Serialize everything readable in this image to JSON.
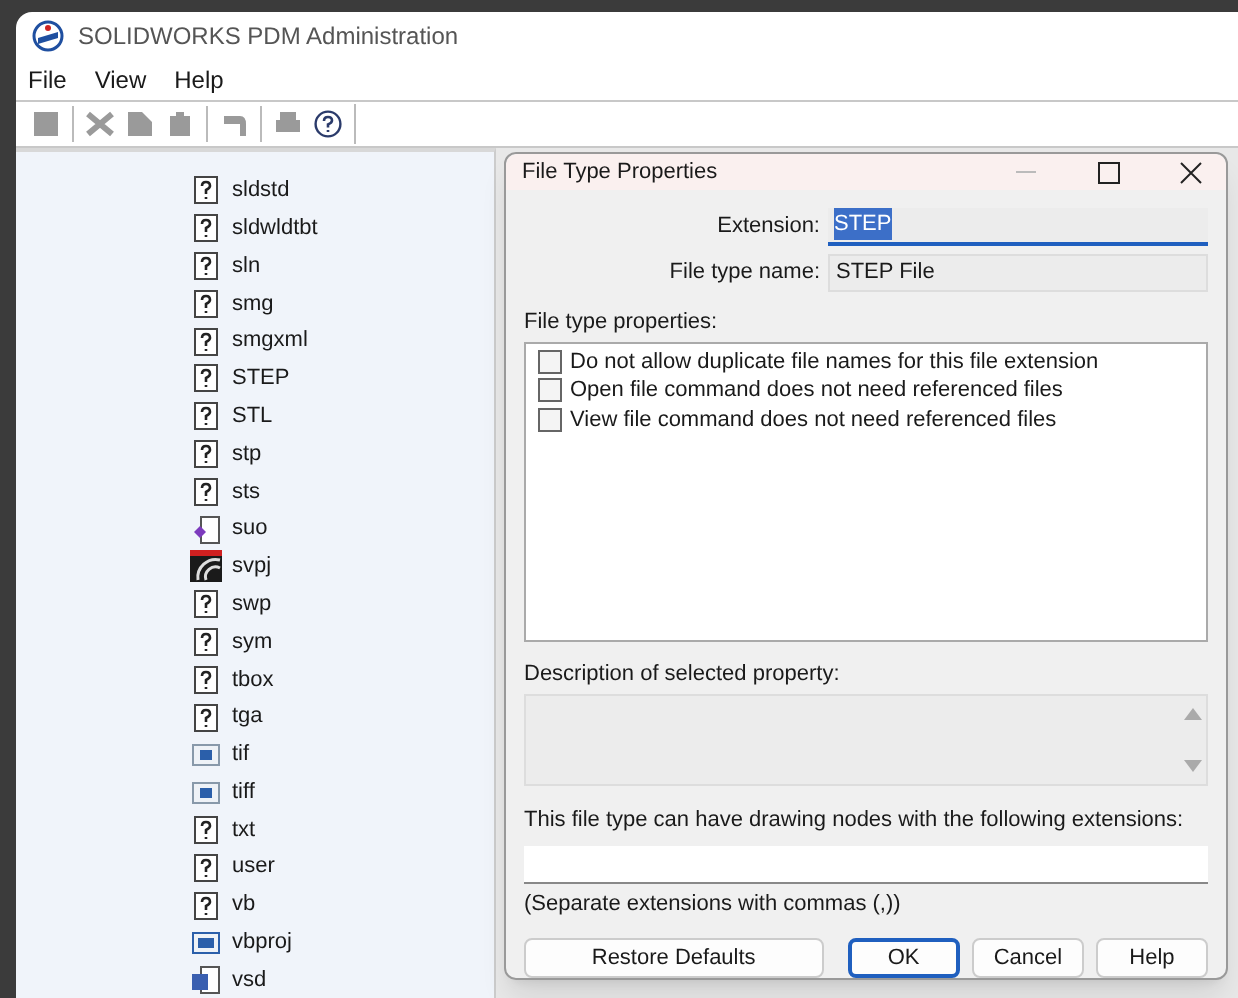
{
  "window": {
    "title": "SOLIDWORKS PDM Administration"
  },
  "menu": [
    "File",
    "View",
    "Help"
  ],
  "tree": {
    "items": [
      {
        "label": "sldstd",
        "kind": "unknown"
      },
      {
        "label": "sldwldtbt",
        "kind": "unknown"
      },
      {
        "label": "sln",
        "kind": "unknown"
      },
      {
        "label": "smg",
        "kind": "unknown"
      },
      {
        "label": "smgxml",
        "kind": "unknown"
      },
      {
        "label": "STEP",
        "kind": "unknown"
      },
      {
        "label": "STL",
        "kind": "unknown"
      },
      {
        "label": "stp",
        "kind": "unknown"
      },
      {
        "label": "sts",
        "kind": "unknown"
      },
      {
        "label": "suo",
        "kind": "solution"
      },
      {
        "label": "svpj",
        "kind": "svpj"
      },
      {
        "label": "swp",
        "kind": "unknown"
      },
      {
        "label": "sym",
        "kind": "unknown"
      },
      {
        "label": "tbox",
        "kind": "unknown"
      },
      {
        "label": "tga",
        "kind": "unknown"
      },
      {
        "label": "tif",
        "kind": "image"
      },
      {
        "label": "tiff",
        "kind": "image"
      },
      {
        "label": "txt",
        "kind": "unknown"
      },
      {
        "label": "user",
        "kind": "unknown"
      },
      {
        "label": "vb",
        "kind": "unknown"
      },
      {
        "label": "vbproj",
        "kind": "vb"
      },
      {
        "label": "vsd",
        "kind": "visio"
      }
    ]
  },
  "dialog": {
    "title": "File Type Properties",
    "extension": {
      "label": "Extension:",
      "value": "STEP"
    },
    "file_type_name": {
      "label": "File type name:",
      "value": "STEP File"
    },
    "properties_label": "File type properties:",
    "properties": [
      {
        "label": "Do not allow duplicate file names for this file extension",
        "checked": false
      },
      {
        "label": "Open file command does not need referenced files",
        "checked": false
      },
      {
        "label": "View file command does not need referenced files",
        "checked": false
      }
    ],
    "description_label": "Description of selected property:",
    "drawing_label": "This file type can have drawing nodes with the following extensions:",
    "drawing_note": "(Separate extensions with commas (,))",
    "buttons": [
      {
        "label": "Restore Defaults",
        "default": false
      },
      {
        "label": "OK",
        "default": true
      },
      {
        "label": "Cancel",
        "default": false
      },
      {
        "label": "Help",
        "default": false
      }
    ]
  }
}
